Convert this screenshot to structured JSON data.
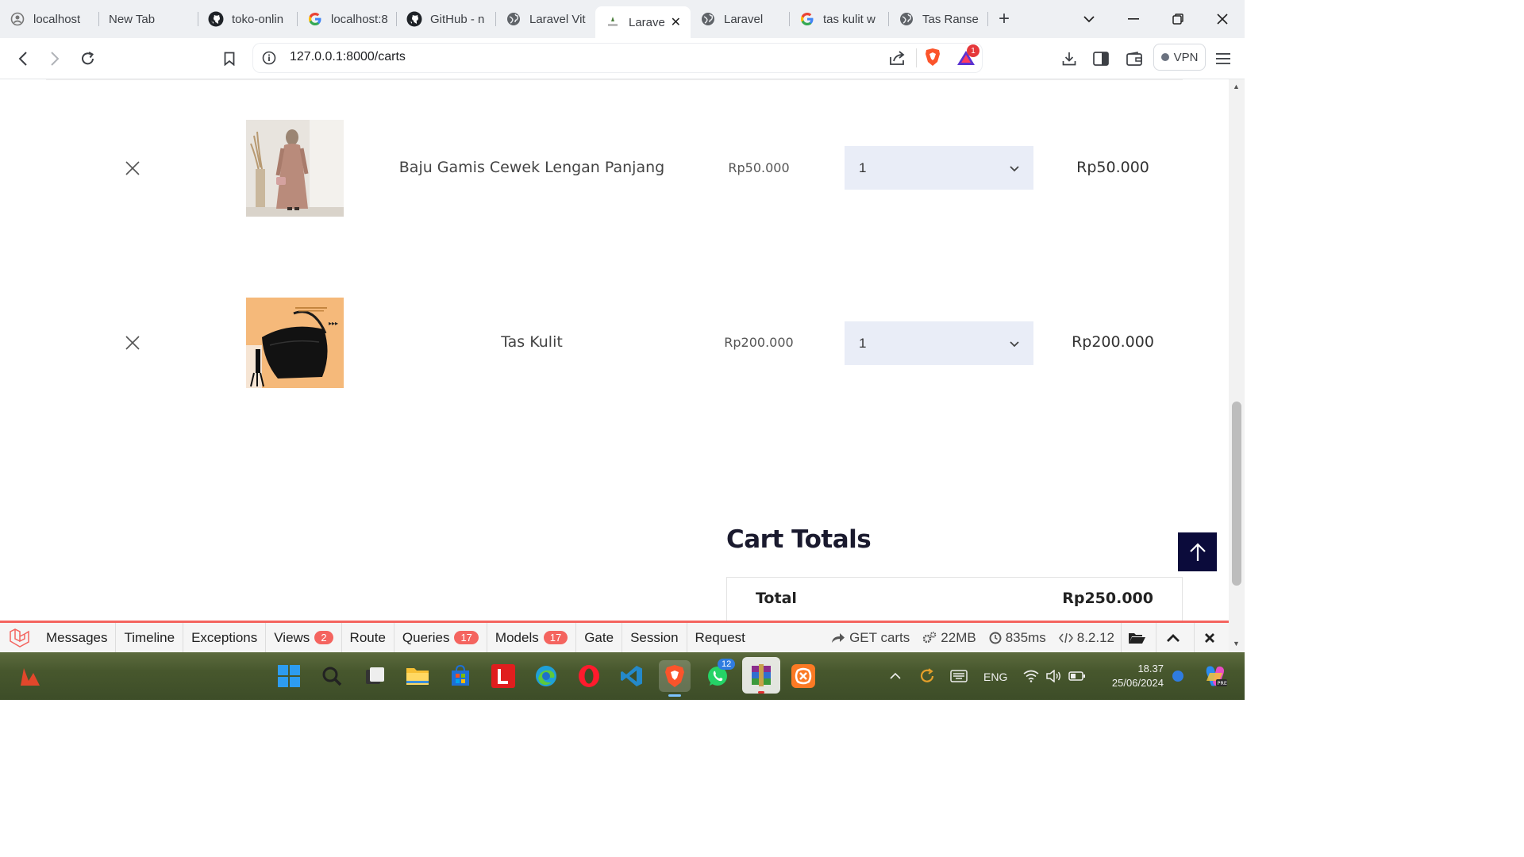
{
  "browser": {
    "tabs": [
      {
        "label": "localhost",
        "icon": "server-icon"
      },
      {
        "label": "New Tab",
        "icon": ""
      },
      {
        "label": "toko-onlin",
        "icon": "github-icon"
      },
      {
        "label": "localhost:8",
        "icon": "google-icon"
      },
      {
        "label": "GitHub - n",
        "icon": "github-icon"
      },
      {
        "label": "Laravel Vit",
        "icon": "globe-icon"
      },
      {
        "label": "Larave",
        "icon": "app-logo-icon",
        "active": true
      },
      {
        "label": "Laravel",
        "icon": "globe-icon"
      },
      {
        "label": "tas kulit w",
        "icon": "google-icon"
      },
      {
        "label": "Tas Ransel",
        "icon": "globe-icon"
      }
    ],
    "url": "127.0.0.1:8000/carts",
    "notification_count": "1",
    "vpn_label": "VPN"
  },
  "cart": {
    "items": [
      {
        "name": "Baju Gamis Cewek Lengan Panjang",
        "price": "Rp50.000",
        "qty": "1",
        "subtotal": "Rp50.000",
        "image": "dress-photo"
      },
      {
        "name": "Tas Kulit",
        "price": "Rp200.000",
        "qty": "1",
        "subtotal": "Rp200.000",
        "image": "handbag-photo"
      }
    ],
    "totals_title": "Cart Totals",
    "total_label": "Total",
    "total_value": "Rp250.000"
  },
  "debugbar": {
    "items": [
      {
        "label": "Messages"
      },
      {
        "label": "Timeline"
      },
      {
        "label": "Exceptions"
      },
      {
        "label": "Views",
        "badge": "2"
      },
      {
        "label": "Route"
      },
      {
        "label": "Queries",
        "badge": "17"
      },
      {
        "label": "Models",
        "badge": "17"
      },
      {
        "label": "Gate"
      },
      {
        "label": "Session"
      },
      {
        "label": "Request"
      }
    ],
    "route": "GET carts",
    "memory": "22MB",
    "time": "835ms",
    "php": "8.2.12",
    "accent": "#f4645f"
  },
  "taskbar": {
    "whatsapp_badge": "12",
    "lang": "ENG",
    "time": "18.37",
    "date": "25/06/2024"
  }
}
